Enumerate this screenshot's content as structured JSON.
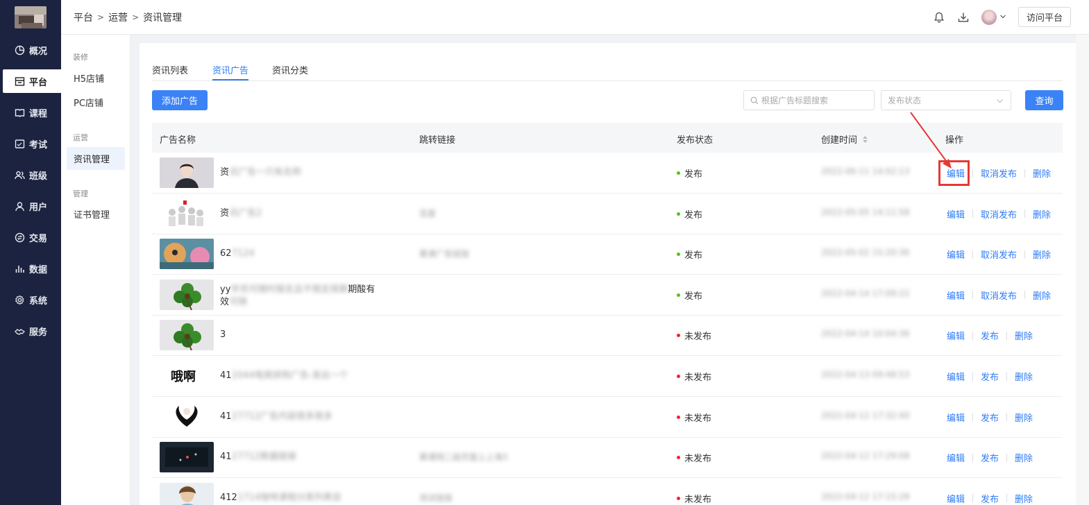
{
  "breadcrumb": [
    "平台",
    "运营",
    "资讯管理"
  ],
  "header": {
    "visit_label": "访问平台",
    "icons": [
      "bell-icon",
      "download-icon",
      "avatar",
      "chevron-down-icon"
    ]
  },
  "nav": {
    "items": [
      {
        "label": "概况",
        "icon": "pie-chart-icon"
      },
      {
        "label": "平台",
        "icon": "store-icon",
        "active": true
      },
      {
        "label": "课程",
        "icon": "book-icon"
      },
      {
        "label": "考试",
        "icon": "exam-icon"
      },
      {
        "label": "班级",
        "icon": "group-icon"
      },
      {
        "label": "用户",
        "icon": "user-icon"
      },
      {
        "label": "交易",
        "icon": "exchange-icon"
      },
      {
        "label": "数据",
        "icon": "bar-chart-icon"
      },
      {
        "label": "系统",
        "icon": "gear-icon"
      },
      {
        "label": "服务",
        "icon": "handshake-icon"
      }
    ]
  },
  "subnav": {
    "groups": [
      {
        "title": "装修",
        "items": [
          "H5店铺",
          "PC店铺"
        ]
      },
      {
        "title": "运营",
        "items": [
          "资讯管理"
        ]
      },
      {
        "title": "管理",
        "items": [
          "证书管理"
        ]
      }
    ],
    "active": "资讯管理"
  },
  "tabs": [
    {
      "label": "资讯列表"
    },
    {
      "label": "资讯广告",
      "active": true
    },
    {
      "label": "资讯分类"
    }
  ],
  "toolbar": {
    "add_label": "添加广告",
    "search_placeholder": "根据广告标题搜索",
    "status_placeholder": "发布状态",
    "query_label": "查询"
  },
  "table": {
    "columns": [
      "广告名称",
      "跳转链接",
      "发布状态",
      "创建时间",
      "操作"
    ],
    "rows": [
      {
        "name_visible": "资",
        "name_blurred": "讯广告一只有名称",
        "link": "",
        "status": "发布",
        "created": "2022-06-11 14:02:13",
        "ops": [
          "编辑",
          "取消发布",
          "删除"
        ],
        "thumb": "portrait"
      },
      {
        "name_visible": "资",
        "name_blurred": "讯广告2",
        "link": "百度",
        "status": "发布",
        "created": "2022-05-05 14:11:58",
        "ops": [
          "编辑",
          "取消发布",
          "删除"
        ],
        "thumb": "people"
      },
      {
        "name_visible": "62",
        "name_blurred": "7124",
        "link": "慕课广告链接",
        "status": "发布",
        "created": "2022-05-02 15:20:36",
        "ops": [
          "编辑",
          "取消发布",
          "删除"
        ],
        "thumb": "painting"
      },
      {
        "name_visible": "yy",
        "name_blurred": "学员可随时报名且不限定周期",
        "name_visible_end": "期酸有",
        "name_line2_visible": "效",
        "name_line2_blurred": "可随",
        "link": "",
        "status": "发布",
        "created": "2022-04-14 17:09:22",
        "ops": [
          "编辑",
          "取消发布",
          "删除"
        ],
        "thumb": "clover"
      },
      {
        "name_visible": "3",
        "name_blurred": "",
        "link": "",
        "status": "未发布",
        "created": "2022-04-14 10:04:36",
        "ops": [
          "编辑",
          "发布",
          "删除"
        ],
        "thumb": "clover"
      },
      {
        "name_visible": "41",
        "name_blurred": "2044电商拼购广告-发出一个",
        "link": "",
        "status": "未发布",
        "created": "2022-04-13 09:48:53",
        "ops": [
          "编辑",
          "发布",
          "删除"
        ],
        "thumb": "text-logo"
      },
      {
        "name_visible": "41",
        "name_blurred": "27712广告内容很多很多",
        "link": "",
        "status": "未发布",
        "created": "2022-04-12 17:32:40",
        "ops": [
          "编辑",
          "发布",
          "删除"
        ],
        "thumb": "heart-logo"
      },
      {
        "name_visible": "41",
        "name_blurred": "27712数据链接",
        "link": "慕课网二级页面上上海3",
        "link_end": "3",
        "status": "未发布",
        "created": "2022-04-12 17:29:08",
        "ops": [
          "编辑",
          "发布",
          "删除"
        ],
        "thumb": "dark-screen"
      },
      {
        "name_visible": "412",
        "name_blurred": "1714咖啡课程分类列表显",
        "link": "测试链接",
        "status": "未发布",
        "created": "2022-04-12 17:15:28",
        "ops": [
          "编辑",
          "发布",
          "删除"
        ],
        "thumb": "girl"
      }
    ]
  },
  "colors": {
    "nav_bg": "#1b2340",
    "primary": "#3b82f6",
    "published_dot": "#52c41a",
    "unpublished_dot": "#f5222d",
    "annotation": "#e53935"
  }
}
